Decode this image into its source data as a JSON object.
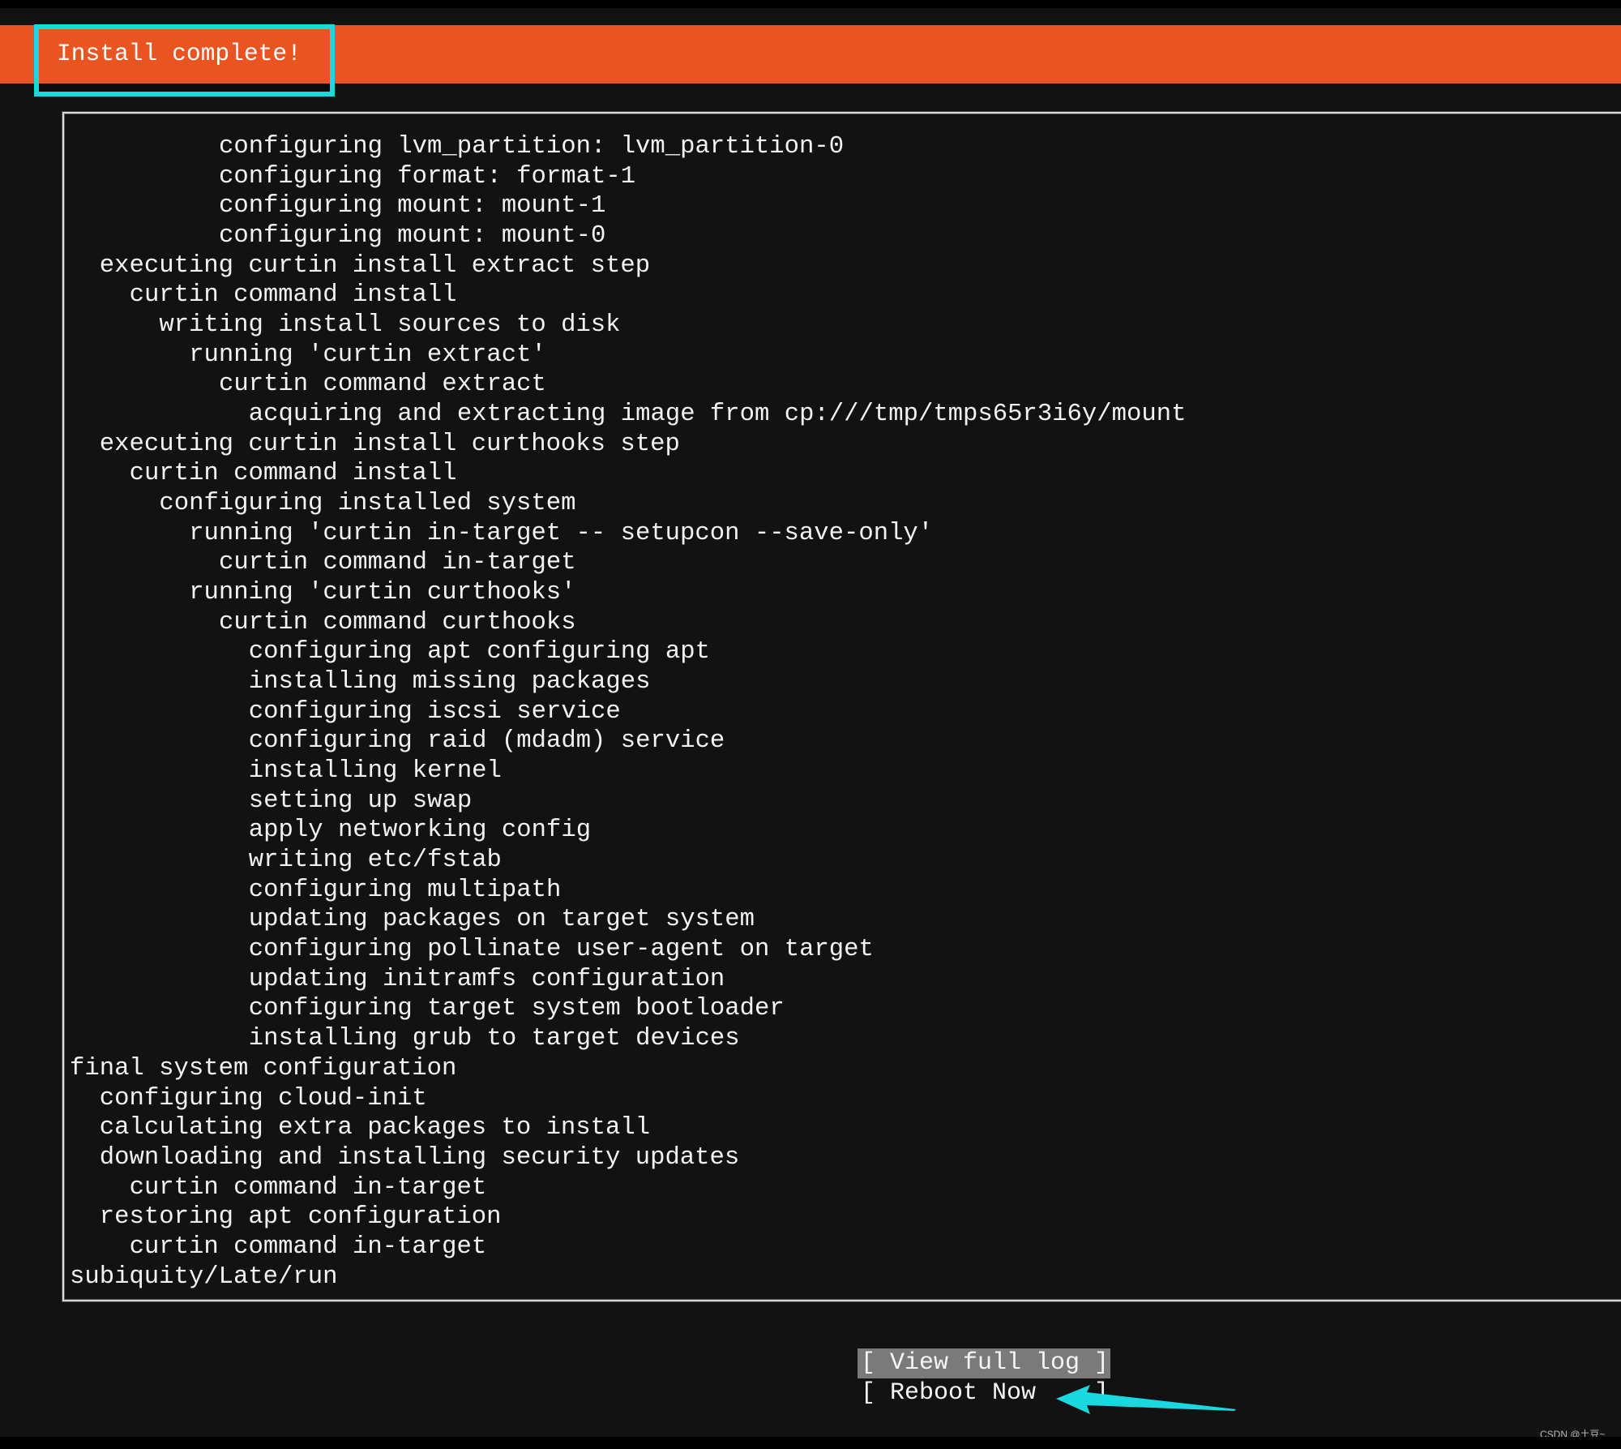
{
  "header": {
    "title": "Install complete!",
    "accent_color": "#E95420",
    "annotation_color": "#19D9DF"
  },
  "log": {
    "lines": [
      {
        "indent": 10,
        "text": "configuring lvm_partition: lvm_partition-0"
      },
      {
        "indent": 10,
        "text": "configuring format: format-1"
      },
      {
        "indent": 10,
        "text": "configuring mount: mount-1"
      },
      {
        "indent": 10,
        "text": "configuring mount: mount-0"
      },
      {
        "indent": 2,
        "text": "executing curtin install extract step"
      },
      {
        "indent": 4,
        "text": "curtin command install"
      },
      {
        "indent": 6,
        "text": "writing install sources to disk"
      },
      {
        "indent": 8,
        "text": "running 'curtin extract'"
      },
      {
        "indent": 10,
        "text": "curtin command extract"
      },
      {
        "indent": 12,
        "text": "acquiring and extracting image from cp:///tmp/tmps65r3i6y/mount"
      },
      {
        "indent": 2,
        "text": "executing curtin install curthooks step"
      },
      {
        "indent": 4,
        "text": "curtin command install"
      },
      {
        "indent": 6,
        "text": "configuring installed system"
      },
      {
        "indent": 8,
        "text": "running 'curtin in-target -- setupcon --save-only'"
      },
      {
        "indent": 10,
        "text": "curtin command in-target"
      },
      {
        "indent": 8,
        "text": "running 'curtin curthooks'"
      },
      {
        "indent": 10,
        "text": "curtin command curthooks"
      },
      {
        "indent": 12,
        "text": "configuring apt configuring apt"
      },
      {
        "indent": 12,
        "text": "installing missing packages"
      },
      {
        "indent": 12,
        "text": "configuring iscsi service"
      },
      {
        "indent": 12,
        "text": "configuring raid (mdadm) service"
      },
      {
        "indent": 12,
        "text": "installing kernel"
      },
      {
        "indent": 12,
        "text": "setting up swap"
      },
      {
        "indent": 12,
        "text": "apply networking config"
      },
      {
        "indent": 12,
        "text": "writing etc/fstab"
      },
      {
        "indent": 12,
        "text": "configuring multipath"
      },
      {
        "indent": 12,
        "text": "updating packages on target system"
      },
      {
        "indent": 12,
        "text": "configuring pollinate user-agent on target"
      },
      {
        "indent": 12,
        "text": "updating initramfs configuration"
      },
      {
        "indent": 12,
        "text": "configuring target system bootloader"
      },
      {
        "indent": 12,
        "text": "installing grub to target devices"
      },
      {
        "indent": 0,
        "text": "final system configuration"
      },
      {
        "indent": 2,
        "text": "configuring cloud-init"
      },
      {
        "indent": 2,
        "text": "calculating extra packages to install"
      },
      {
        "indent": 2,
        "text": "downloading and installing security updates"
      },
      {
        "indent": 4,
        "text": "curtin command in-target"
      },
      {
        "indent": 2,
        "text": "restoring apt configuration"
      },
      {
        "indent": 4,
        "text": "curtin command in-target"
      },
      {
        "indent": 0,
        "text": "subiquity/Late/run"
      }
    ]
  },
  "buttons": {
    "view_full_log": "[ View full log ]",
    "reboot_now": "[ Reboot Now    ]"
  },
  "watermark": "CSDN @土豆~"
}
